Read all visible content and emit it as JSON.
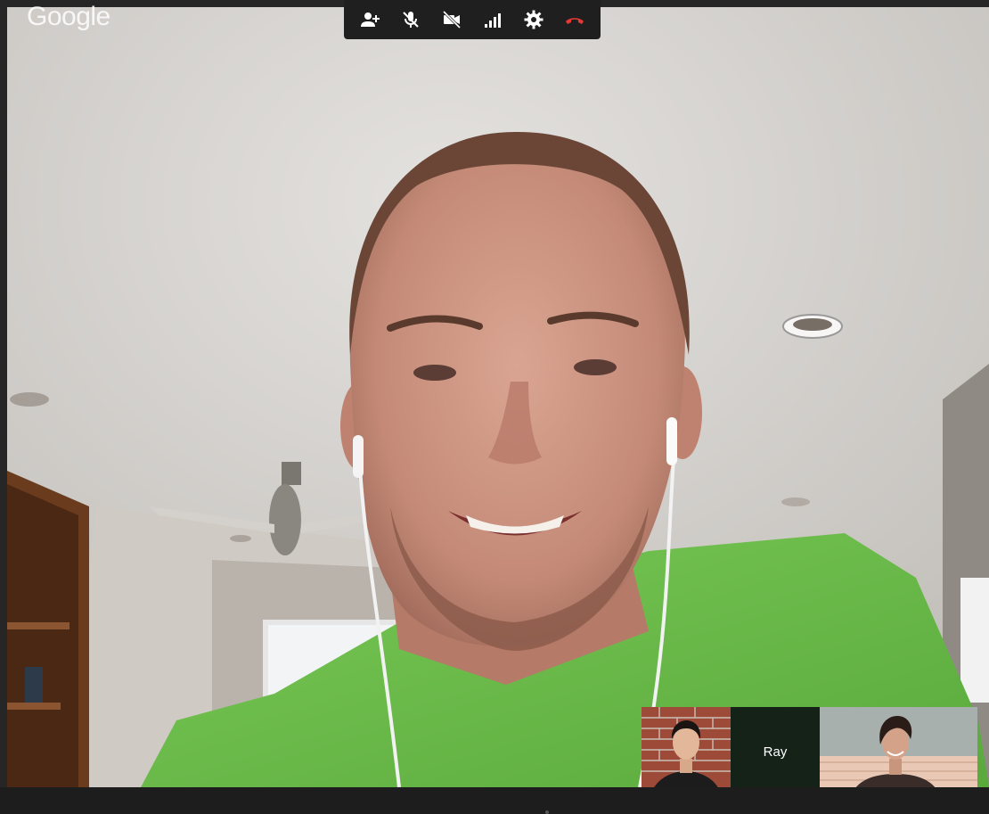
{
  "app": {
    "logo_text": "Google"
  },
  "toolbar": {
    "buttons": [
      {
        "name": "invite-people-button",
        "icon": "person-add-icon"
      },
      {
        "name": "mute-mic-button",
        "icon": "mic-off-icon"
      },
      {
        "name": "camera-off-button",
        "icon": "videocam-off-icon"
      },
      {
        "name": "bandwidth-button",
        "icon": "signal-bars-icon"
      },
      {
        "name": "settings-button",
        "icon": "gear-icon"
      },
      {
        "name": "hang-up-button",
        "icon": "phone-hangup-icon"
      }
    ],
    "hangup_color": "#e53935"
  },
  "participants": [
    {
      "label": "",
      "kind": "video"
    },
    {
      "label": "Ray",
      "kind": "name-tile"
    },
    {
      "label": "",
      "kind": "video"
    }
  ],
  "colors": {
    "shirt": "#6cc04a",
    "ceiling": "#d9d7d3"
  }
}
